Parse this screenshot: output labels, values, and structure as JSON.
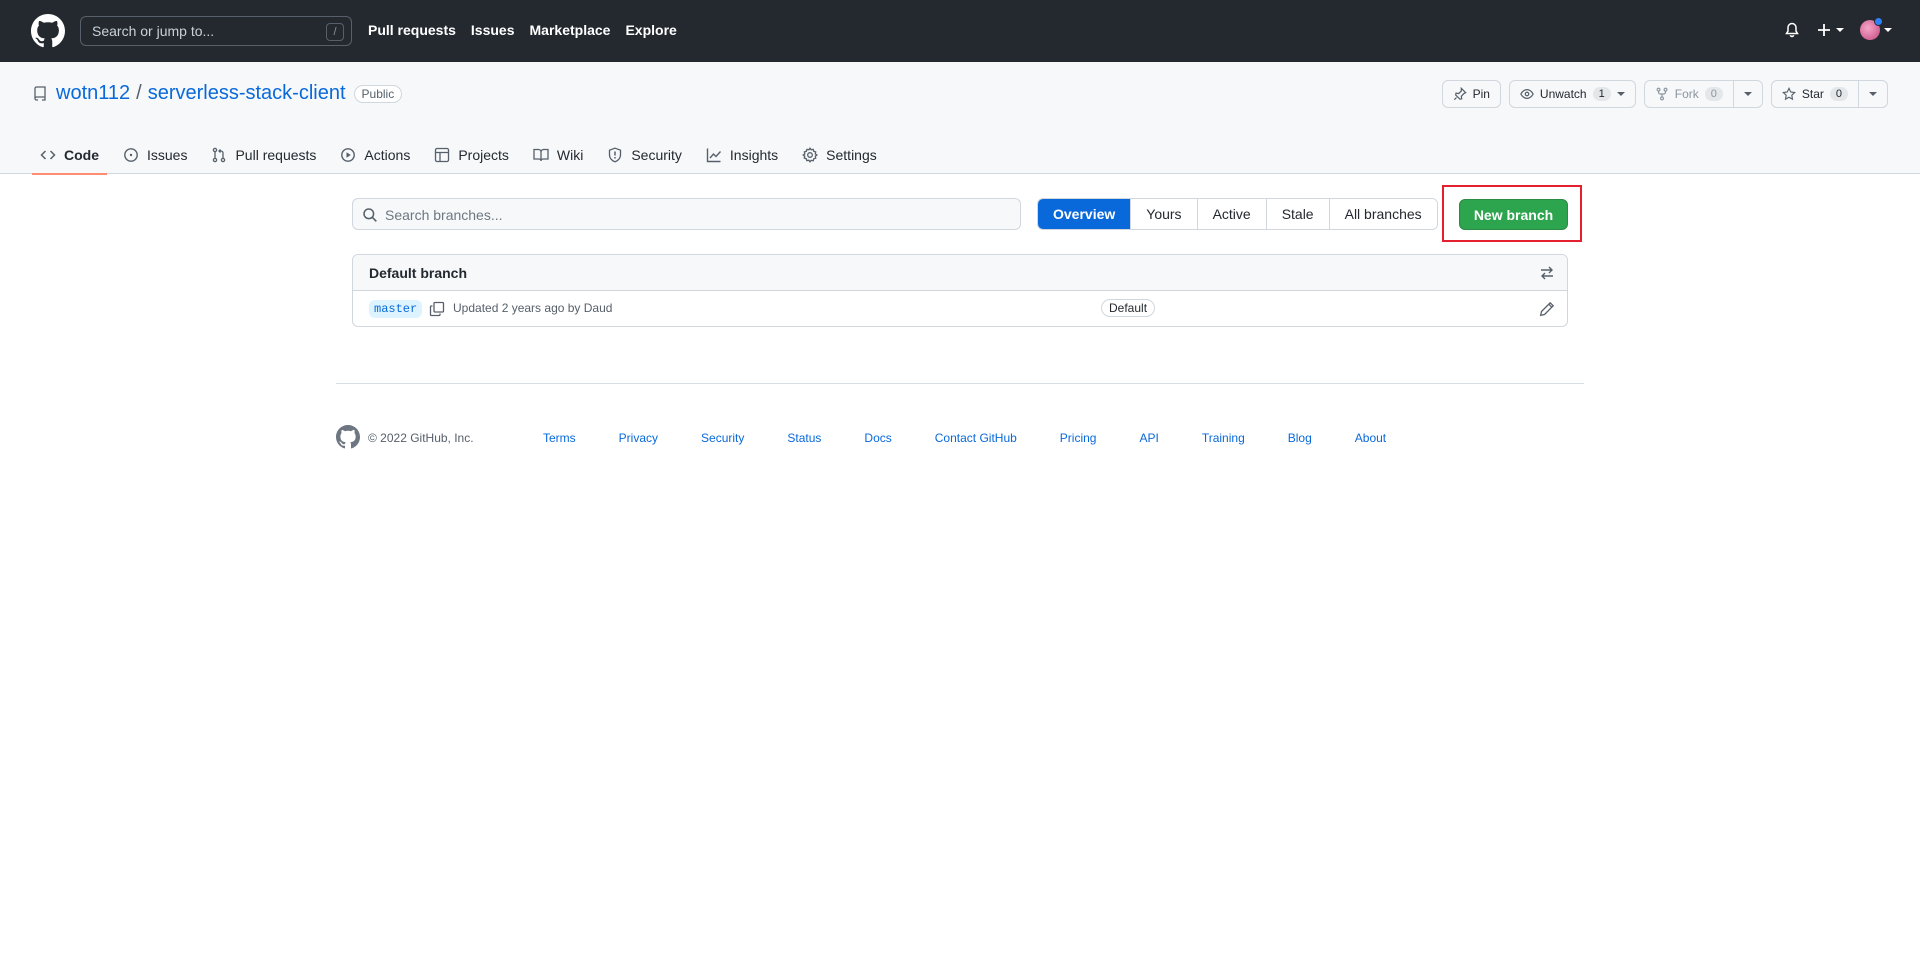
{
  "header": {
    "search_placeholder": "Search or jump to...",
    "search_shortcut": "/",
    "nav": [
      "Pull requests",
      "Issues",
      "Marketplace",
      "Explore"
    ]
  },
  "repo": {
    "owner": "wotn112",
    "separator": "/",
    "name": "serverless-stack-client",
    "visibility": "Public",
    "actions": {
      "pin": "Pin",
      "unwatch": "Unwatch",
      "watch_count": "1",
      "fork": "Fork",
      "fork_count": "0",
      "star": "Star",
      "star_count": "0"
    },
    "tabs": [
      "Code",
      "Issues",
      "Pull requests",
      "Actions",
      "Projects",
      "Wiki",
      "Security",
      "Insights",
      "Settings"
    ],
    "selected_tab": "Code"
  },
  "branches": {
    "search_placeholder": "Search branches...",
    "filters": [
      "Overview",
      "Yours",
      "Active",
      "Stale",
      "All branches"
    ],
    "active_filter": "Overview",
    "new_branch": "New branch",
    "default_section_title": "Default branch",
    "default_branch": {
      "name": "master",
      "meta": "Updated 2 years ago by Daud",
      "badge": "Default"
    }
  },
  "footer": {
    "copyright": "© 2022 GitHub, Inc.",
    "links": [
      "Terms",
      "Privacy",
      "Security",
      "Status",
      "Docs",
      "Contact GitHub",
      "Pricing",
      "API",
      "Training",
      "Blog",
      "About"
    ]
  },
  "colors": {
    "header_bg": "#24292f",
    "accent_blue": "#0969da",
    "green_button": "#2da44e",
    "tab_underline": "#fd8c73",
    "highlight_box": "#e5202e"
  }
}
